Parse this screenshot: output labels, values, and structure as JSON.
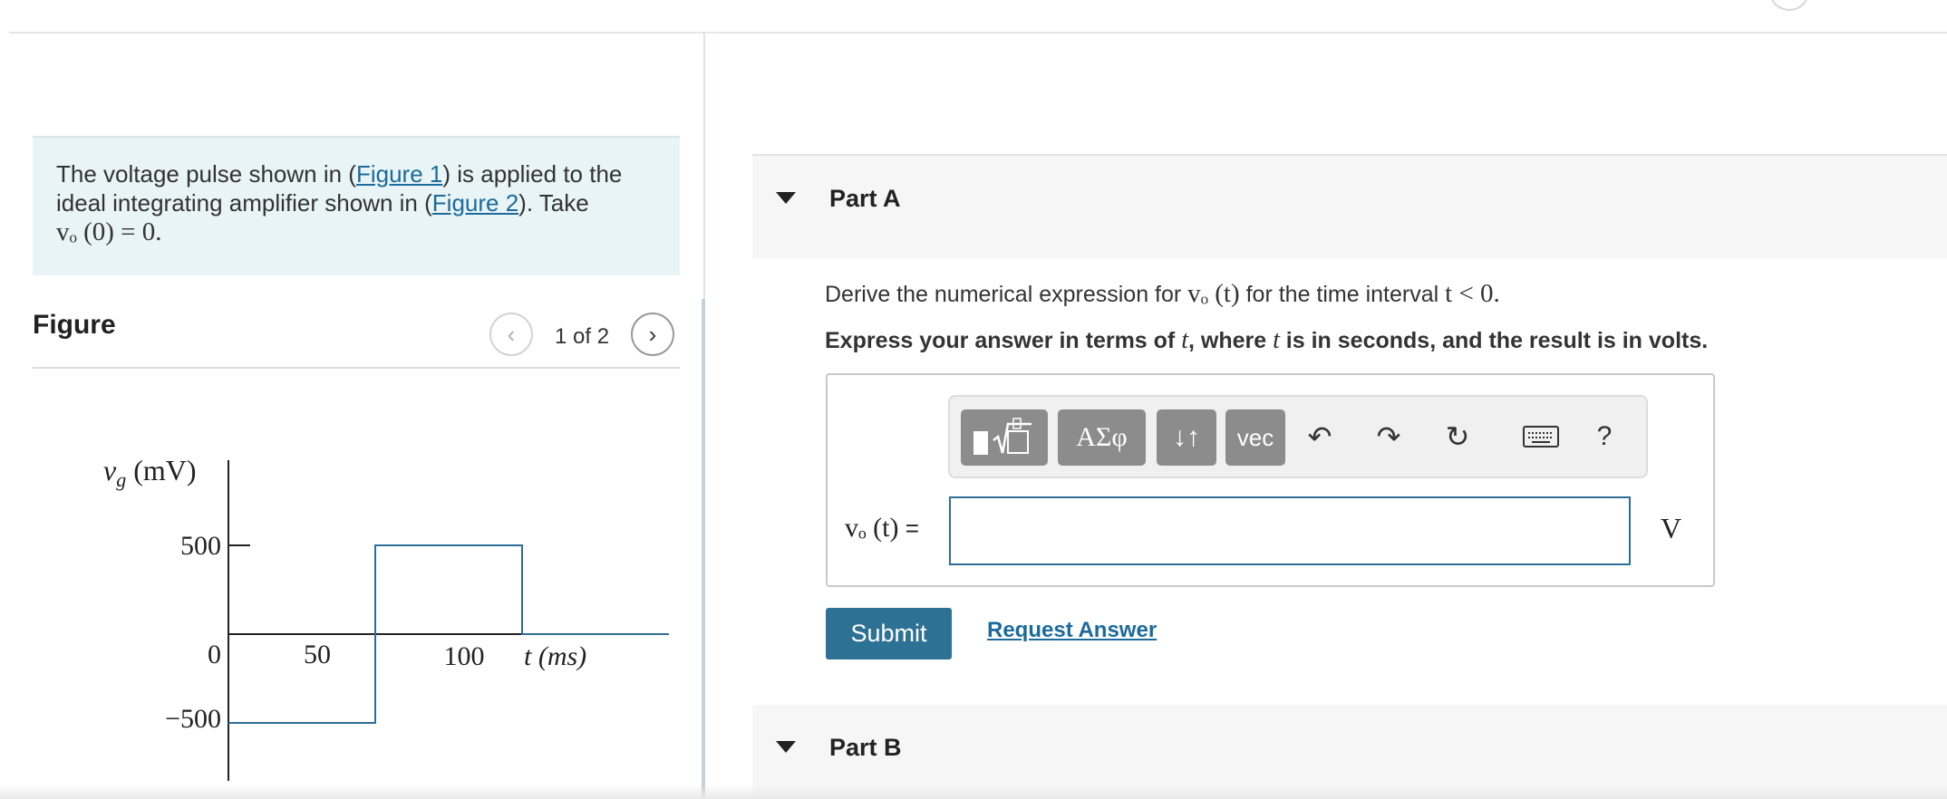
{
  "problem": {
    "text_before_fig1": "The voltage pulse shown in (",
    "figure1_link": "Figure 1",
    "text_between": ") is applied to the ideal integrating amplifier shown in (",
    "figure2_link": "Figure 2",
    "text_after": "). Take",
    "initial_condition": "vₒ (0) = 0."
  },
  "figure": {
    "title": "Figure",
    "page_indicator": "1 of 2",
    "graph": {
      "y_axis_label": "v",
      "y_axis_sub": "g",
      "y_axis_unit": " (mV)",
      "x_axis_label": "t (ms)",
      "ticks_y": [
        "500",
        "0",
        "−500"
      ],
      "ticks_x": [
        "50",
        "100"
      ]
    }
  },
  "chart_data": {
    "type": "line",
    "x": [
      0,
      50,
      50,
      100,
      100,
      150
    ],
    "y": [
      -500,
      -500,
      500,
      500,
      0,
      0
    ],
    "xlabel": "t (ms)",
    "ylabel": "vg (mV)",
    "xticks": [
      0,
      50,
      100
    ],
    "yticks": [
      -500,
      0,
      500
    ],
    "colors": {
      "series": "#2c6e95",
      "axes": "#222222"
    }
  },
  "partA": {
    "title": "Part A",
    "instruction_prefix": "Derive the numerical expression for ",
    "instruction_var": "vₒ (t)",
    "instruction_mid": " for the time interval ",
    "instruction_cond": "t < 0.",
    "express_prefix": "Express your answer in terms of ",
    "express_t1": "t",
    "express_mid": ", where ",
    "express_t2": "t",
    "express_suffix": " is in seconds, and the result is in volts.",
    "toolbar": {
      "templates_icon": "templates-icon",
      "greek_label": "ΑΣφ",
      "arrows_label": "↓↑",
      "vec_label": "vec",
      "help_label": "?"
    },
    "equation_label_var": "vₒ (t)",
    "equation_label_eq": " =",
    "answer_value": "",
    "unit": "V",
    "submit_label": "Submit",
    "request_answer_label": "Request Answer"
  },
  "partB": {
    "title": "Part B"
  },
  "colors": {
    "accent": "#2d7295",
    "link": "#1c6b9b",
    "problem_bg": "#e8f4f6",
    "toolbar_button": "#8c8c8c"
  }
}
